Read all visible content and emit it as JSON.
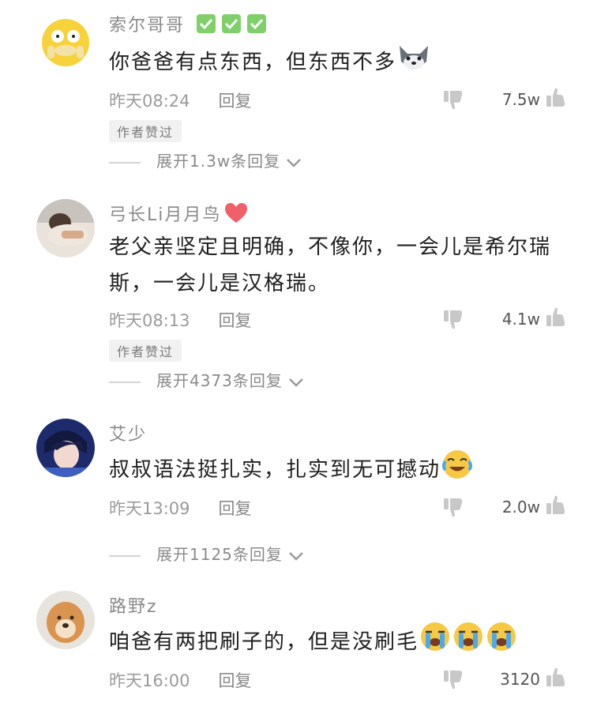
{
  "comments": [
    {
      "username": "索尔哥哥",
      "username_emojis": [
        "check-mark-emoji",
        "check-mark-emoji",
        "check-mark-emoji"
      ],
      "text": "你爸爸有点东西，但东西不多",
      "text_emoji": "doge-emoji",
      "time": "昨天08:24",
      "reply_label": "回复",
      "like_count": "7.5w",
      "author_badge": "作者赞过",
      "expand_label": "展开1.3w条回复"
    },
    {
      "username": "弓长Li月月鸟",
      "username_emojis": [
        "red-heart-emoji"
      ],
      "text": "老父亲坚定且明确，不像你，一会儿是希尔瑞斯，一会儿是汉格瑞。",
      "time": "昨天08:13",
      "reply_label": "回复",
      "like_count": "4.1w",
      "author_badge": "作者赞过",
      "expand_label": "展开4373条回复"
    },
    {
      "username": "艾少",
      "text": "叔叔语法挺扎实，扎实到无可撼动",
      "text_emoji": "crying-laughing-emoji",
      "time": "昨天13:09",
      "reply_label": "回复",
      "like_count": "2.0w",
      "expand_label": "展开1125条回复"
    },
    {
      "username": "路野z",
      "text": "咱爸有两把刷子的，但是没刷毛",
      "text_emojis": [
        "loudly-crying-emoji",
        "loudly-crying-emoji",
        "loudly-crying-emoji"
      ],
      "time": "昨天16:00",
      "reply_label": "回复",
      "like_count": "3120"
    }
  ],
  "colors": {
    "name": "#8a8a8a",
    "text": "#1f1f1f",
    "meta": "#9b9b9b",
    "icon": "#c8c8c8",
    "heart": "#f0606b",
    "check": "#7fcf6a"
  }
}
